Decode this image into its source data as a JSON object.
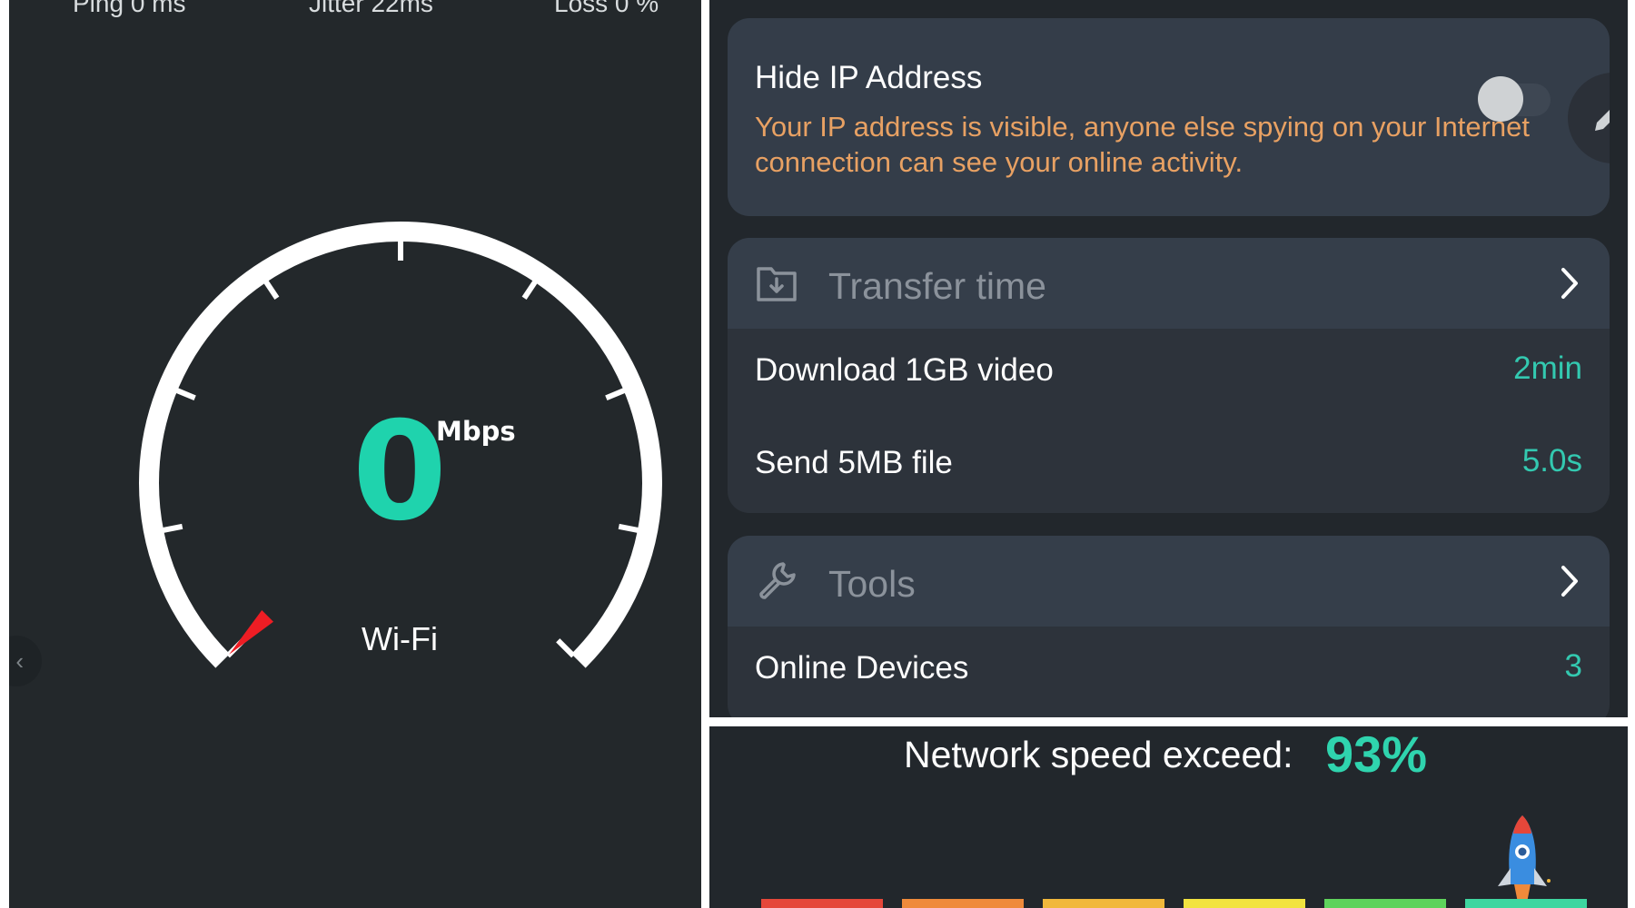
{
  "speed_test": {
    "top_stats": [
      "Ping 0 ms",
      "Jitter 22ms",
      "Loss 0 %"
    ],
    "speed_value": "0",
    "unit": "Mbps",
    "connection_type": "Wi-Fi",
    "needle_fraction": 0.0
  },
  "hide_ip": {
    "title": "Hide IP Address",
    "description": "Your IP address is visible, anyone else spying on your Internet connection can see your online activity.",
    "enabled": false
  },
  "transfer_time": {
    "header": "Transfer time",
    "rows": [
      {
        "label": "Download 1GB video",
        "value": "2min"
      },
      {
        "label": "Send 5MB file",
        "value": "5.0s"
      }
    ]
  },
  "tools": {
    "header": "Tools",
    "rows": [
      {
        "label": "Online Devices",
        "value": "3"
      }
    ]
  },
  "network_speed": {
    "label": "Network speed exceed:",
    "percent": "93%",
    "bar_colors": [
      "#e5473a",
      "#ef8a3b",
      "#f1b83c",
      "#f2e340",
      "#5fd35c",
      "#3fd6a0"
    ]
  },
  "colors": {
    "accent_teal": "#1fd3ad",
    "warning_orange": "#e8a163",
    "needle_red": "#ee1d24"
  }
}
